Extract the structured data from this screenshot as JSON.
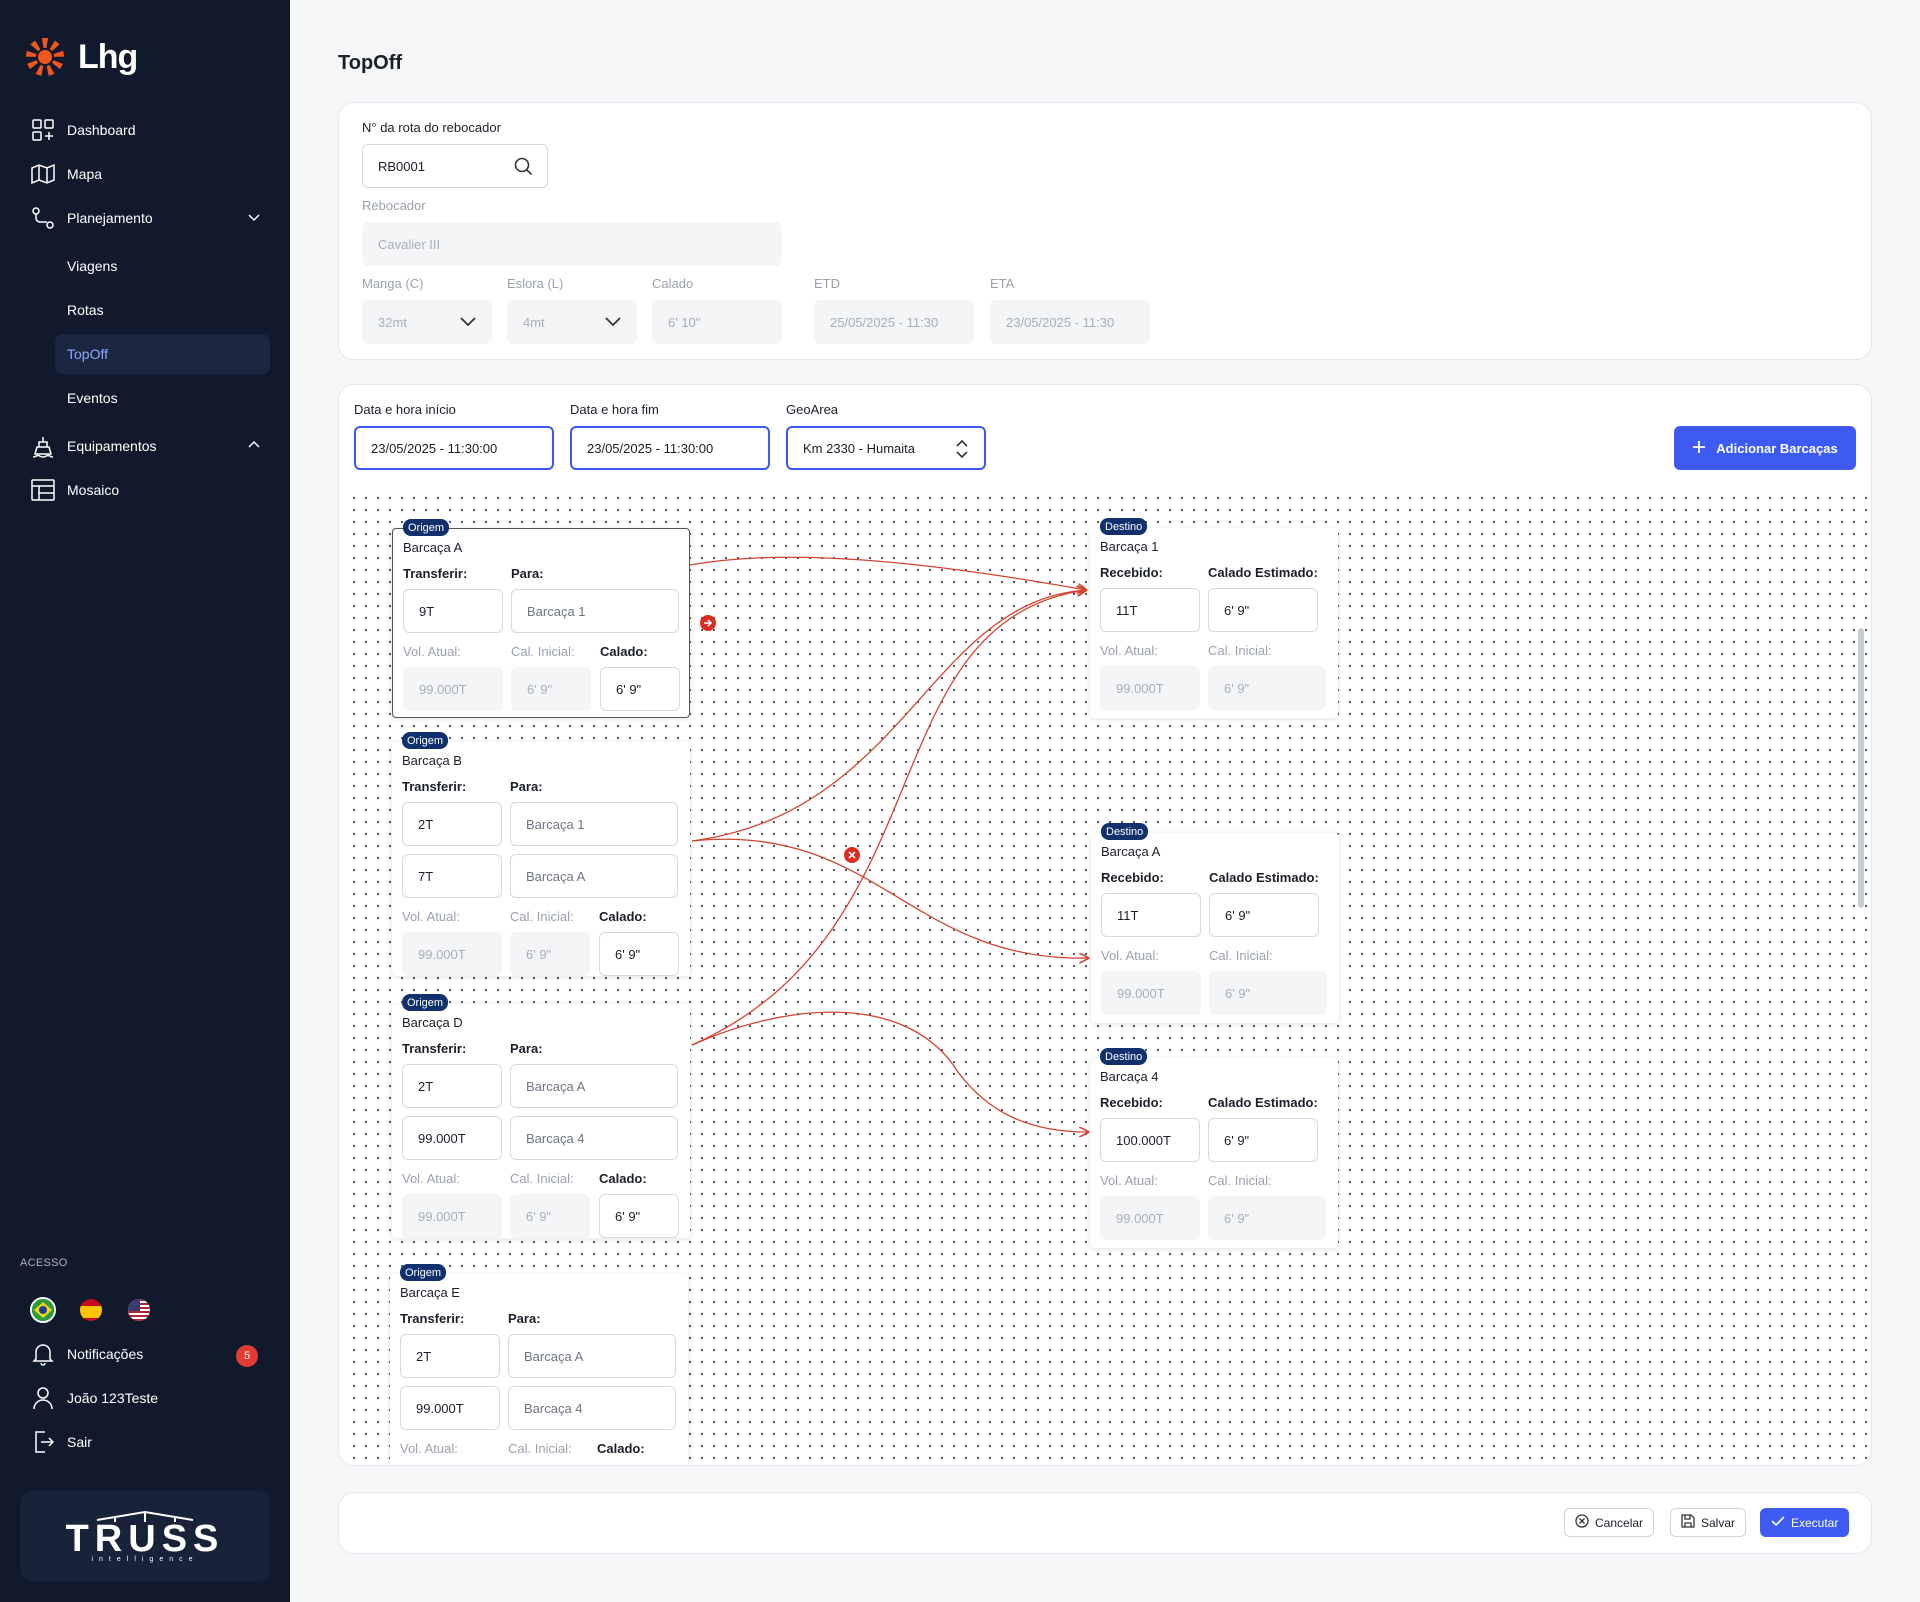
{
  "app": {
    "logo": "Lhg",
    "page_title": "TopOff"
  },
  "sidebar": {
    "nav": [
      {
        "label": "Dashboard",
        "icon": "dashboard-icon"
      },
      {
        "label": "Mapa",
        "icon": "map-icon"
      },
      {
        "label": "Planejamento",
        "icon": "route-icon"
      },
      {
        "label": "Equipamentos",
        "icon": "ship-icon"
      },
      {
        "label": "Mosaico",
        "icon": "grid-icon"
      }
    ],
    "sub": [
      "Viagens",
      "Rotas",
      "TopOff",
      "Eventos"
    ],
    "active_sub": "TopOff",
    "access_label": "ACESSO",
    "languages": [
      "pt-BR",
      "es",
      "en-US"
    ],
    "notifications": {
      "label": "Notificações",
      "count": "5"
    },
    "user": "João 123Teste",
    "logout": "Sair",
    "brand": {
      "name": "TRUSS",
      "sub": "intelligence"
    }
  },
  "route_card": {
    "route_label": "N° da rota do rebocador",
    "route_value": "RB0001",
    "tug_label": "Rebocador",
    "tug_value": "Cavalier III",
    "manga_label": "Manga (C)",
    "manga_value": "32mt",
    "eslora_label": "Eslora (L)",
    "eslora_value": "4mt",
    "calado_label": "Calado",
    "calado_value": "6' 10\"",
    "etd_label": "ETD",
    "etd_value": "25/05/2025 - 11:30",
    "eta_label": "ETA",
    "eta_value": "23/05/2025 - 11:30"
  },
  "filters": {
    "start_label": "Data e hora início",
    "start_value": "23/05/2025 - 11:30:00",
    "end_label": "Data e hora fim",
    "end_value": "23/05/2025 - 11:30:00",
    "geo_label": "GeoArea",
    "geo_value": "Km 2330 - Humaita",
    "add_button": "Adicionar Barcaças"
  },
  "labels": {
    "origin_tag": "Origem",
    "dest_tag": "Destino",
    "transfer": "Transferir:",
    "to": "Para:",
    "vol": "Vol. Atual:",
    "cal_init": "Cal. Inicial:",
    "calado": "Calado:",
    "received": "Recebido:",
    "est_draft": "Calado Estimado:"
  },
  "origins": [
    {
      "name": "Barcaça A",
      "transfers": [
        {
          "qty": "9T",
          "to": "Barcaça 1"
        }
      ],
      "vol": "99.000T",
      "cal_init": "6' 9\"",
      "calado": "6' 9\""
    },
    {
      "name": "Barcaça B",
      "transfers": [
        {
          "qty": "2T",
          "to": "Barcaça 1"
        },
        {
          "qty": "7T",
          "to": "Barcaça A"
        }
      ],
      "vol": "99.000T",
      "cal_init": "6' 9\"",
      "calado": "6' 9\""
    },
    {
      "name": "Barcaça D",
      "transfers": [
        {
          "qty": "2T",
          "to": "Barcaça A"
        },
        {
          "qty": "99.000T",
          "to": "Barcaça 4"
        }
      ],
      "vol": "99.000T",
      "cal_init": "6' 9\"",
      "calado": "6' 9\""
    },
    {
      "name": "Barcaça E",
      "transfers": [
        {
          "qty": "2T",
          "to": "Barcaça A"
        },
        {
          "qty": "99.000T",
          "to": "Barcaça 4"
        }
      ]
    }
  ],
  "destinations": [
    {
      "name": "Barcaça 1",
      "received": "11T",
      "est": "6' 9\"",
      "vol": "99.000T",
      "cal_init": "6' 9\""
    },
    {
      "name": "Barcaça A",
      "received": "11T",
      "est": "6' 9\"",
      "vol": "99.000T",
      "cal_init": "6' 9\""
    },
    {
      "name": "Barcaça 4",
      "received": "100.000T",
      "est": "6' 9\"",
      "vol": "99.000T",
      "cal_init": "6' 9\""
    }
  ],
  "footer": {
    "cancel": "Cancelar",
    "save": "Salvar",
    "execute": "Executar"
  },
  "colors": {
    "sidebar": "#111a2c",
    "accent": "#3d5bf3",
    "edge": "#d2432e",
    "tag": "#10306e"
  }
}
